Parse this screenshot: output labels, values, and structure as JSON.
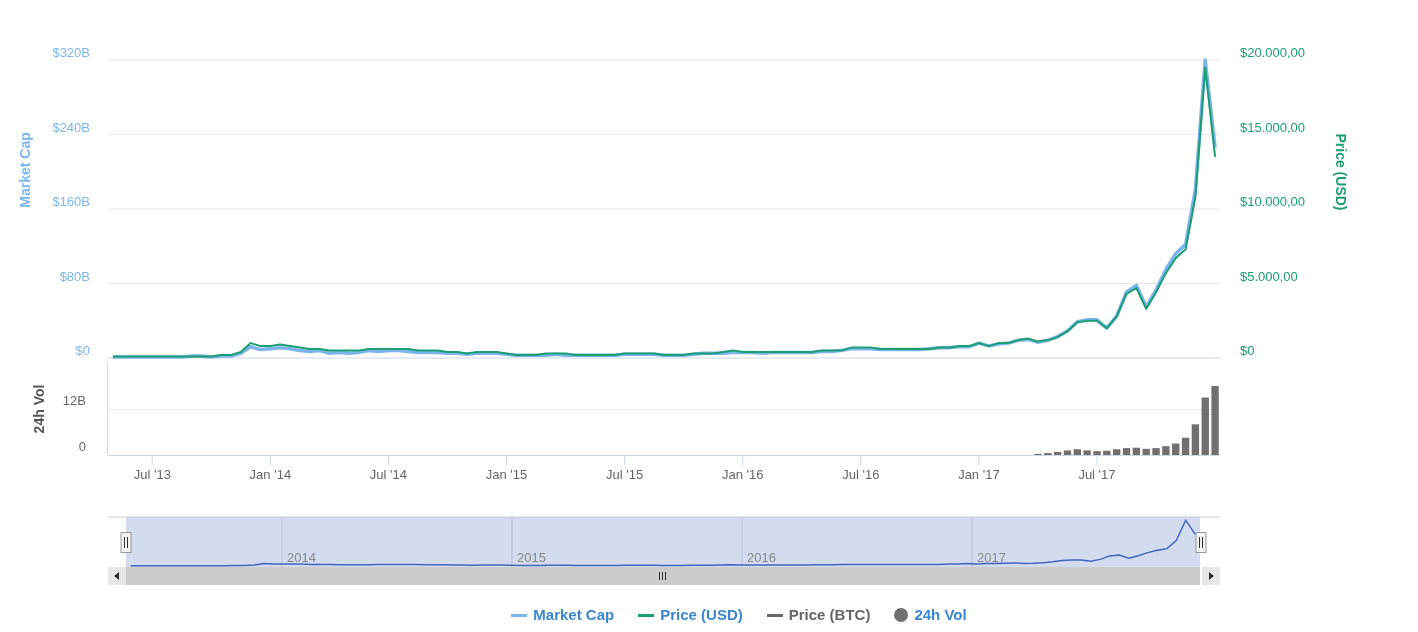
{
  "market_cap_chart": {
    "chart_data": {
      "type": "line",
      "ylabel": "Market Cap",
      "grid": true,
      "ylim": [
        0,
        320
      ],
      "yticks": [
        {
          "value": 0,
          "label": "$0"
        },
        {
          "value": 80,
          "label": "$80B"
        },
        {
          "value": 160,
          "label": "$160B"
        },
        {
          "value": 240,
          "label": "$240B"
        },
        {
          "value": 320,
          "label": "$320B"
        }
      ],
      "categories": [
        null,
        null,
        null,
        null,
        null,
        null,
        null,
        null,
        null,
        null,
        null,
        null,
        null,
        null,
        null,
        null,
        null,
        null,
        null,
        null,
        null,
        null,
        null,
        null,
        null,
        null,
        null,
        null,
        null,
        null,
        null,
        null,
        null,
        null,
        null,
        null,
        null,
        null,
        null,
        null,
        null,
        null,
        null,
        null,
        null,
        null,
        null,
        null,
        null,
        null,
        null,
        null,
        null,
        null,
        null,
        null,
        null,
        null,
        null,
        null,
        null,
        null,
        null,
        null,
        null,
        null,
        null,
        null,
        null,
        null,
        null,
        null,
        null,
        null,
        null,
        null,
        null,
        null,
        null,
        null,
        null,
        null,
        null,
        null,
        null,
        null,
        null,
        null,
        null,
        null,
        null,
        null,
        null,
        null,
        null,
        null,
        null,
        null,
        null,
        null,
        null,
        null,
        null,
        null,
        null,
        null,
        null,
        null,
        null,
        null,
        null,
        null,
        null
      ],
      "series": [
        {
          "color": "#7cb5ec",
          "values": [
            1,
            1,
            1,
            1,
            1,
            1,
            1,
            1,
            2,
            2,
            1,
            2,
            2,
            5,
            12,
            9,
            10,
            11,
            10,
            8,
            7,
            8,
            5,
            6,
            5,
            6,
            8,
            7,
            8,
            8,
            7,
            6,
            6,
            6,
            5,
            5,
            4,
            5,
            5,
            5,
            4,
            3,
            3,
            3,
            3,
            4,
            3,
            3,
            3,
            3,
            3,
            3,
            4,
            4,
            4,
            4,
            3,
            3,
            3,
            4,
            5,
            5,
            5,
            6,
            6,
            6,
            5,
            6,
            6,
            6,
            6,
            6,
            7,
            7,
            8,
            10,
            10,
            10,
            9,
            9,
            9,
            9,
            9,
            10,
            11,
            11,
            12,
            12,
            16,
            13,
            15,
            16,
            19,
            20,
            17,
            19,
            23,
            29,
            39,
            41,
            41,
            32,
            45,
            71,
            78,
            55,
            73,
            95,
            112,
            122,
            181,
            320,
            226
          ]
        }
      ]
    }
  },
  "price_chart": {
    "chart_data": {
      "type": "line",
      "ylabel": "Price (USD)",
      "ylim": [
        0,
        20000
      ],
      "yticks": [
        {
          "value": 0,
          "label": "$0"
        },
        {
          "value": 5000,
          "label": "$5.000,00"
        },
        {
          "value": 10000,
          "label": "$10.000,00"
        },
        {
          "value": 15000,
          "label": "$15.000,00"
        },
        {
          "value": 20000,
          "label": "$20.000,00"
        }
      ],
      "categories": [
        null,
        null,
        null,
        null,
        null,
        null,
        null,
        null,
        null,
        null,
        null,
        null,
        null,
        null,
        null,
        null,
        null,
        null,
        null,
        null,
        null,
        null,
        null,
        null,
        null,
        null,
        null,
        null,
        null,
        null,
        null,
        null,
        null,
        null,
        null,
        null,
        null,
        null,
        null,
        null,
        null,
        null,
        null,
        null,
        null,
        null,
        null,
        null,
        null,
        null,
        null,
        null,
        null,
        null,
        null,
        null,
        null,
        null,
        null,
        null,
        null,
        null,
        null,
        null,
        null,
        null,
        null,
        null,
        null,
        null,
        null,
        null,
        null,
        null,
        null,
        null,
        null,
        null,
        null,
        null,
        null,
        null,
        null,
        null,
        null,
        null,
        null,
        null,
        null,
        null,
        null,
        null,
        null,
        null,
        null,
        null,
        null,
        null,
        null,
        null,
        null,
        null,
        null,
        null,
        null,
        null,
        null,
        null,
        null,
        null,
        null,
        null,
        null
      ],
      "series": [
        {
          "color": "#1a9e72",
          "values": [
            100,
            100,
            100,
            100,
            100,
            100,
            100,
            100,
            100,
            100,
            100,
            200,
            200,
            400,
            1000,
            800,
            800,
            900,
            800,
            700,
            600,
            600,
            500,
            500,
            500,
            500,
            600,
            600,
            600,
            600,
            600,
            500,
            500,
            500,
            400,
            400,
            300,
            400,
            400,
            400,
            300,
            200,
            200,
            200,
            300,
            300,
            300,
            200,
            200,
            200,
            200,
            200,
            300,
            300,
            300,
            300,
            200,
            200,
            200,
            300,
            300,
            300,
            400,
            500,
            400,
            400,
            400,
            400,
            400,
            400,
            400,
            400,
            500,
            500,
            500,
            700,
            700,
            700,
            600,
            600,
            600,
            600,
            600,
            600,
            700,
            700,
            800,
            800,
            1000,
            800,
            1000,
            1000,
            1200,
            1300,
            1100,
            1200,
            1400,
            1800,
            2400,
            2500,
            2500,
            2000,
            2800,
            4300,
            4700,
            3300,
            4400,
            5700,
            6700,
            7300,
            10800,
            19500,
            13500
          ]
        }
      ]
    }
  },
  "volume_chart": {
    "chart_data": {
      "type": "bar",
      "ylabel": "24h Vol",
      "ylim": [
        0,
        24
      ],
      "yticks": [
        {
          "value": 0,
          "label": "0"
        },
        {
          "value": 12,
          "label": "12B"
        }
      ],
      "categories": [
        null,
        null,
        null,
        null,
        "Jul '13",
        null,
        null,
        null,
        null,
        null,
        null,
        null,
        null,
        null,
        null,
        null,
        "Jan '14",
        null,
        null,
        null,
        null,
        null,
        null,
        null,
        null,
        null,
        null,
        null,
        "Jul '14",
        null,
        null,
        null,
        null,
        null,
        null,
        null,
        null,
        null,
        null,
        null,
        "Jan '15",
        null,
        null,
        null,
        null,
        null,
        null,
        null,
        null,
        null,
        null,
        null,
        "Jul '15",
        null,
        null,
        null,
        null,
        null,
        null,
        null,
        null,
        null,
        null,
        null,
        "Jan '16",
        null,
        null,
        null,
        null,
        null,
        null,
        null,
        null,
        null,
        null,
        null,
        "Jul '16",
        null,
        null,
        null,
        null,
        null,
        null,
        null,
        null,
        null,
        null,
        null,
        "Jan '17",
        null,
        null,
        null,
        null,
        null,
        null,
        null,
        null,
        null,
        null,
        null,
        "Jul '17",
        null,
        null,
        null,
        null,
        null,
        null,
        null,
        null,
        null,
        null,
        null,
        null
      ],
      "series": [
        {
          "color": "#707070",
          "values": [
            null,
            null,
            null,
            null,
            null,
            null,
            null,
            null,
            null,
            null,
            null,
            null,
            null,
            null,
            null,
            null,
            null,
            null,
            null,
            null,
            null,
            null,
            null,
            null,
            null,
            null,
            null,
            null,
            null,
            null,
            null,
            null,
            null,
            null,
            null,
            null,
            null,
            null,
            null,
            null,
            null,
            null,
            null,
            null,
            null,
            null,
            null,
            null,
            null,
            null,
            null,
            null,
            null,
            null,
            null,
            null,
            null,
            null,
            null,
            null,
            null,
            null,
            null,
            null,
            null,
            null,
            null,
            null,
            null,
            null,
            null,
            null,
            null,
            null,
            null,
            null,
            null,
            null,
            null,
            null,
            null,
            null,
            null,
            null,
            null,
            null,
            null,
            null,
            null,
            null,
            null,
            null,
            null,
            null,
            0.3,
            0.5,
            0.8,
            1.2,
            1.5,
            1.2,
            1.0,
            1.1,
            1.5,
            1.8,
            1.9,
            1.6,
            1.8,
            2.3,
            3.0,
            4.5,
            8.0,
            15.0,
            18.0
          ]
        }
      ]
    }
  },
  "navigator": {
    "year_labels": [
      "2014",
      "2015",
      "2016",
      "2017"
    ]
  },
  "legend": [
    {
      "label": "Market Cap",
      "kind": "line",
      "color": "#7cb5ec",
      "active": true
    },
    {
      "label": "Price (USD)",
      "kind": "line",
      "color": "#1a9e72",
      "active": true
    },
    {
      "label": "Price (BTC)",
      "kind": "line",
      "color": "#666666",
      "active": false
    },
    {
      "label": "24h Vol",
      "kind": "dot",
      "color": "#707070",
      "active": true
    }
  ]
}
